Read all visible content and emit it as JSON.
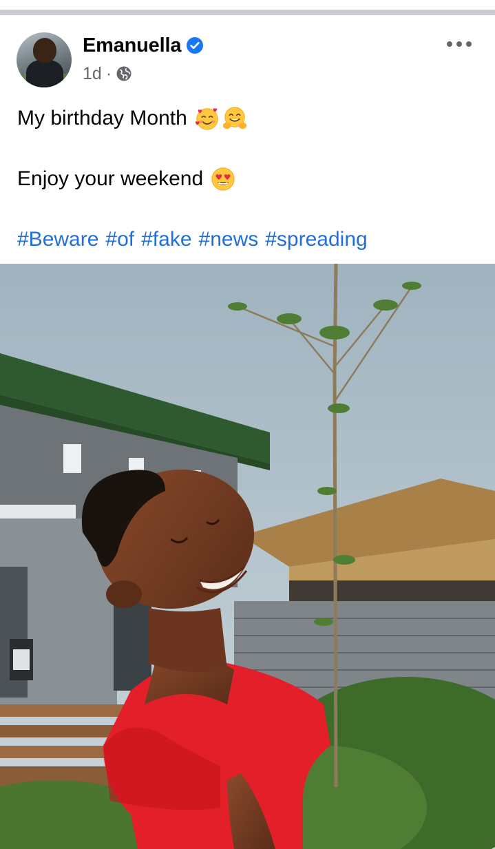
{
  "post": {
    "author": "Emanuella",
    "verified": true,
    "time": "1d",
    "separator": "·",
    "audience_icon": "globe-icon",
    "more_icon": "more-horizontal-icon",
    "lines": [
      {
        "text": "My birthday Month",
        "emojis": [
          "smiling-face-with-hearts-emoji",
          "hugging-face-emoji"
        ]
      },
      {
        "text": "Enjoy your weekend",
        "emojis": [
          "heart-eyes-emoji"
        ]
      }
    ],
    "hashtags": [
      "#Beware",
      "#of",
      "#fake",
      "#news",
      "#spreading"
    ]
  },
  "colors": {
    "link": "#216fdb",
    "meta": "#65676b",
    "verified": "#1877f2",
    "divider": "#c9ccd1"
  }
}
